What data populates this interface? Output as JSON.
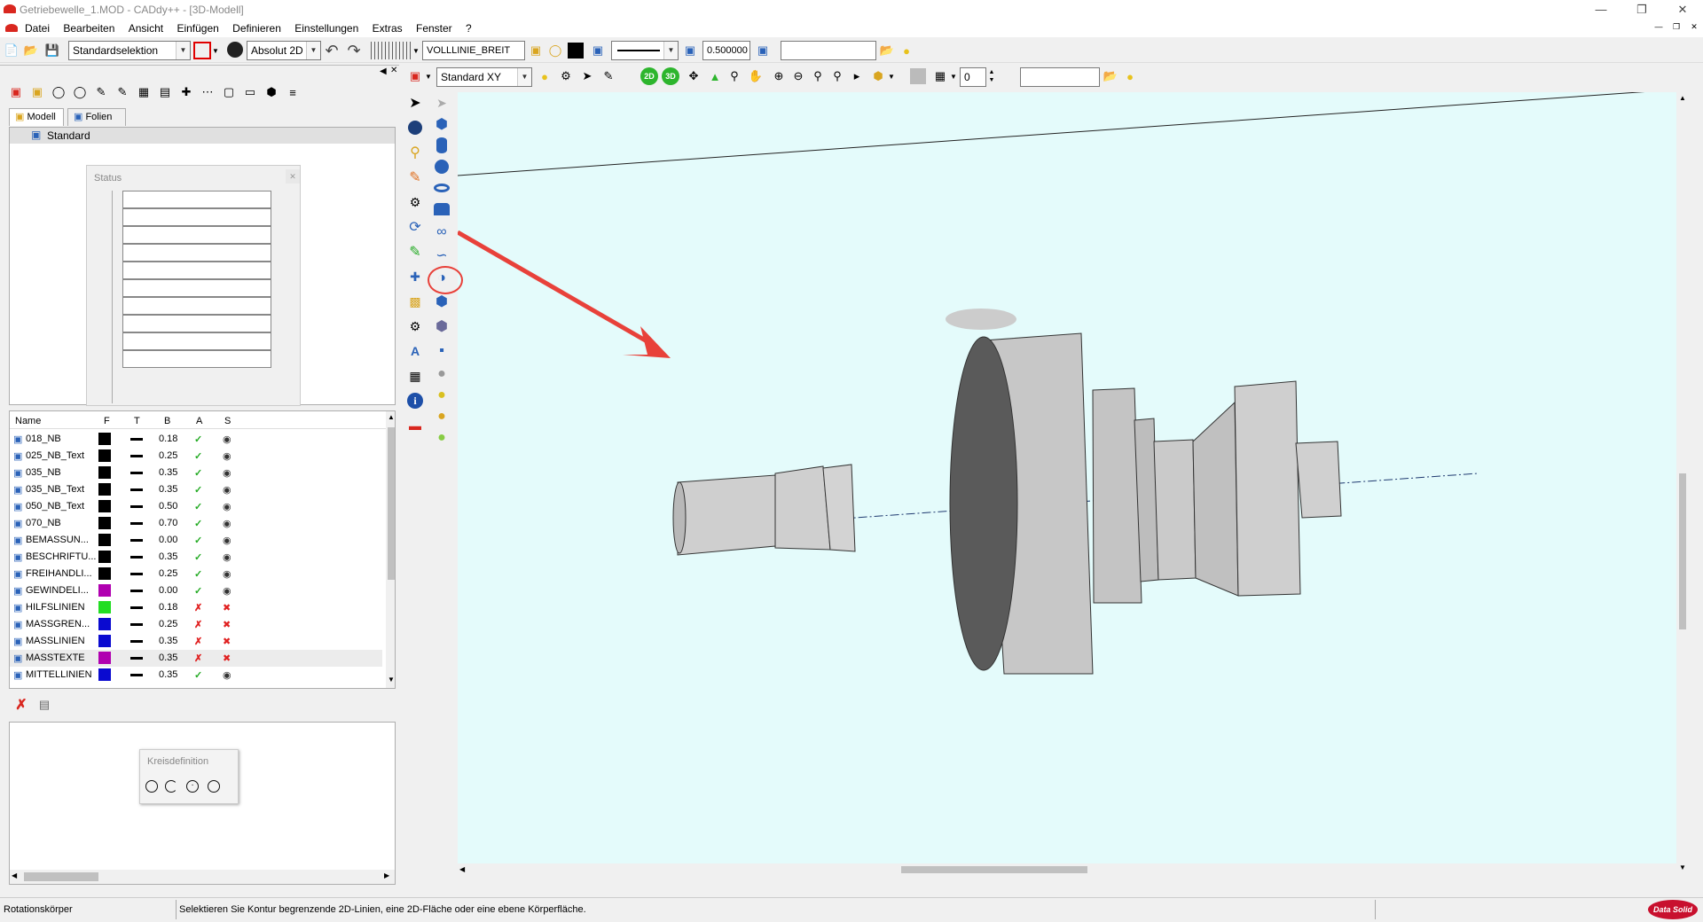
{
  "window": {
    "title": "Getriebewelle_1.MOD - CADdy++ - [3D-Modell]"
  },
  "menu": [
    "Datei",
    "Bearbeiten",
    "Ansicht",
    "Einfügen",
    "Definieren",
    "Einstellungen",
    "Extras",
    "Fenster",
    "?"
  ],
  "toolbar1": {
    "selection_mode": "Standardselektion",
    "coord_mode": "Absolut 2D",
    "linetype": "VOLLLINIE_BREIT",
    "linewidth_value": "0.500000",
    "text_field": ""
  },
  "toolbar2": {
    "view": "Standard XY",
    "layer_value": "0",
    "text_field": ""
  },
  "left_panel": {
    "tabs": [
      "Modell",
      "Folien"
    ],
    "tree_root": "Standard",
    "status_dialog_title": "Status",
    "layer_table": {
      "headers": [
        "Name",
        "F",
        "T",
        "B",
        "A",
        "S"
      ],
      "rows": [
        {
          "name": "018_NB",
          "color": "#000000",
          "width": "0.18",
          "active": true,
          "visible": true
        },
        {
          "name": "025_NB_Text",
          "color": "#000000",
          "width": "0.25",
          "active": true,
          "visible": true
        },
        {
          "name": "035_NB",
          "color": "#000000",
          "width": "0.35",
          "active": true,
          "visible": true
        },
        {
          "name": "035_NB_Text",
          "color": "#000000",
          "width": "0.35",
          "active": true,
          "visible": true
        },
        {
          "name": "050_NB_Text",
          "color": "#000000",
          "width": "0.50",
          "active": true,
          "visible": true
        },
        {
          "name": "070_NB",
          "color": "#000000",
          "width": "0.70",
          "active": true,
          "visible": true
        },
        {
          "name": "BEMASSUN...",
          "color": "#000000",
          "width": "0.00",
          "active": true,
          "visible": true
        },
        {
          "name": "BESCHRIFTU...",
          "color": "#000000",
          "width": "0.35",
          "active": true,
          "visible": true
        },
        {
          "name": "FREIHANDLI...",
          "color": "#000000",
          "width": "0.25",
          "active": true,
          "visible": true
        },
        {
          "name": "GEWINDELI...",
          "color": "#b000b0",
          "width": "0.00",
          "active": true,
          "visible": true
        },
        {
          "name": "HILFSLINIEN",
          "color": "#22dd22",
          "width": "0.18",
          "active": false,
          "visible": false
        },
        {
          "name": "MASSGREN...",
          "color": "#0a0ad0",
          "width": "0.25",
          "active": false,
          "visible": false
        },
        {
          "name": "MASSLINIEN",
          "color": "#0a0ad0",
          "width": "0.35",
          "active": false,
          "visible": false
        },
        {
          "name": "MASSTEXTE",
          "color": "#b000b0",
          "width": "0.35",
          "active": false,
          "visible": false
        },
        {
          "name": "MITTELLINIEN",
          "color": "#0a0ad0",
          "width": "0.35",
          "active": true,
          "visible": true
        }
      ]
    },
    "kreis_dialog_title": "Kreisdefinition"
  },
  "statusbar": {
    "left": "Rotationskörper",
    "message": "Selektieren Sie Kontur begrenzende 2D-Linien, eine 2D-Fläche oder eine ebene Körperfläche."
  },
  "colors": {
    "viewport_bg": "#e4fbfb",
    "accent_arrow": "#e8413a"
  },
  "logo_text": "Data Solid"
}
